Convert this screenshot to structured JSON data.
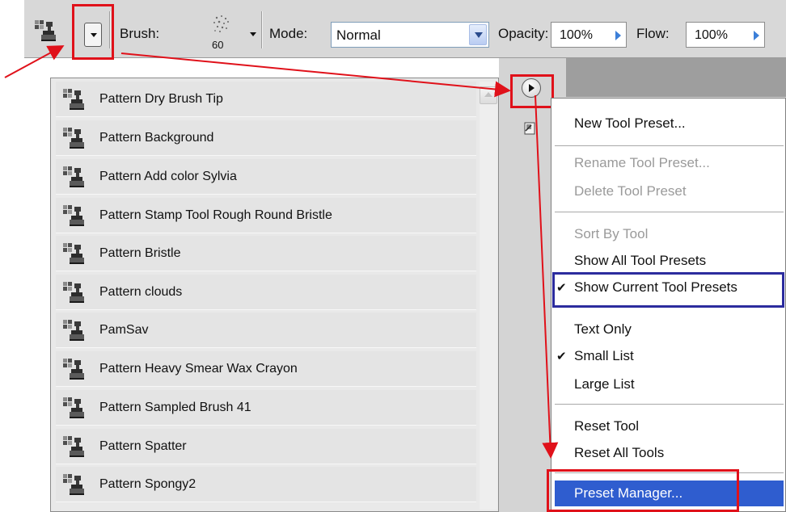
{
  "toolbar": {
    "brush_label": "Brush:",
    "brush_size": "60",
    "mode_label": "Mode:",
    "mode_value": "Normal",
    "opacity_label": "Opacity:",
    "opacity_value": "100%",
    "flow_label": "Flow:",
    "flow_value": "100%"
  },
  "presets": [
    {
      "label": "Pattern Dry Brush Tip"
    },
    {
      "label": "Pattern Background"
    },
    {
      "label": "Pattern Add color Sylvia"
    },
    {
      "label": "Pattern Stamp Tool Rough Round Bristle"
    },
    {
      "label": "Pattern Bristle"
    },
    {
      "label": "Pattern clouds"
    },
    {
      "label": "PamSav"
    },
    {
      "label": "Pattern Heavy Smear Wax Crayon"
    },
    {
      "label": "Pattern Sampled Brush 41"
    },
    {
      "label": "Pattern Spatter"
    },
    {
      "label": "Pattern Spongy2"
    }
  ],
  "menu": {
    "new_tool_preset": "New Tool Preset...",
    "rename_tool_preset": "Rename Tool Preset...",
    "delete_tool_preset": "Delete Tool Preset",
    "sort_by_tool": "Sort By Tool",
    "show_all_tool_presets": "Show All Tool Presets",
    "show_current_tool_presets": "Show Current Tool Presets",
    "text_only": "Text Only",
    "small_list": "Small List",
    "large_list": "Large List",
    "reset_tool": "Reset Tool",
    "reset_all_tools": "Reset All Tools",
    "preset_manager": "Preset Manager...",
    "checkmark": "✔"
  },
  "colors": {
    "annotation_red": "#e0111a",
    "annotation_blue": "#2c2c9e",
    "menu_highlight": "#2f5dcf"
  },
  "icons": {
    "tool": "pattern-stamp-icon",
    "menu": "flyout-menu-icon",
    "new": "new-preset-icon"
  }
}
